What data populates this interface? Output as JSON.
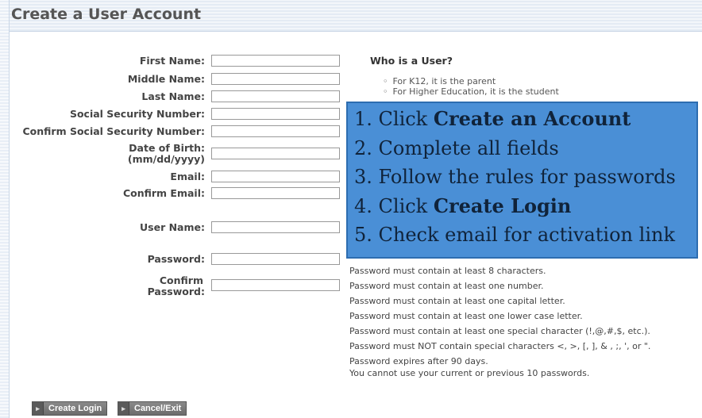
{
  "page": {
    "title": "Create a User Account"
  },
  "form": {
    "fields": [
      {
        "label": "First Name:",
        "value": ""
      },
      {
        "label": "Middle Name:",
        "value": ""
      },
      {
        "label": "Last Name:",
        "value": ""
      },
      {
        "label": "Social Security Number:",
        "value": ""
      },
      {
        "label": "Confirm Social Security Number:",
        "value": ""
      },
      {
        "label": "Date of Birth:",
        "label2": "(mm/dd/yyyy)",
        "value": ""
      },
      {
        "label": "Email:",
        "value": ""
      },
      {
        "label": "Confirm Email:",
        "value": ""
      },
      {
        "label": "User Name:",
        "value": ""
      },
      {
        "label": "Password:",
        "value": ""
      },
      {
        "label": "Confirm",
        "label2": "Password:",
        "value": ""
      }
    ]
  },
  "info": {
    "title": "Who is a User?",
    "items": [
      "For K12, it is the parent",
      "For Higher Education, it is the student"
    ]
  },
  "instructions": {
    "steps": [
      {
        "prefix": "1. Click ",
        "bold": "Create an Account"
      },
      {
        "prefix": "2. Complete all fields",
        "bold": ""
      },
      {
        "prefix": "3. Follow the rules for passwords",
        "bold": ""
      },
      {
        "prefix": "4. Click ",
        "bold": "Create Login"
      },
      {
        "prefix": "5. Check email for activation link",
        "bold": ""
      }
    ]
  },
  "password_rules": [
    "Password must contain at least 8 characters.",
    "Password must contain at least one number.",
    "Password must contain at least one capital letter.",
    "Password must contain at least one lower case letter.",
    "Password must contain at least one special character (!,@,#,$, etc.).",
    "Password must NOT contain special characters <, >, [, ], & , ;, ', or \".",
    "Password expires after 90 days.",
    "You cannot use your current or previous 10 passwords."
  ],
  "buttons": {
    "create_login": "Create Login",
    "cancel_exit": "Cancel/Exit"
  },
  "colors": {
    "overlay_fill": "#4a8fd6",
    "overlay_border": "#2d6db0",
    "button": "#6c6c6c"
  }
}
